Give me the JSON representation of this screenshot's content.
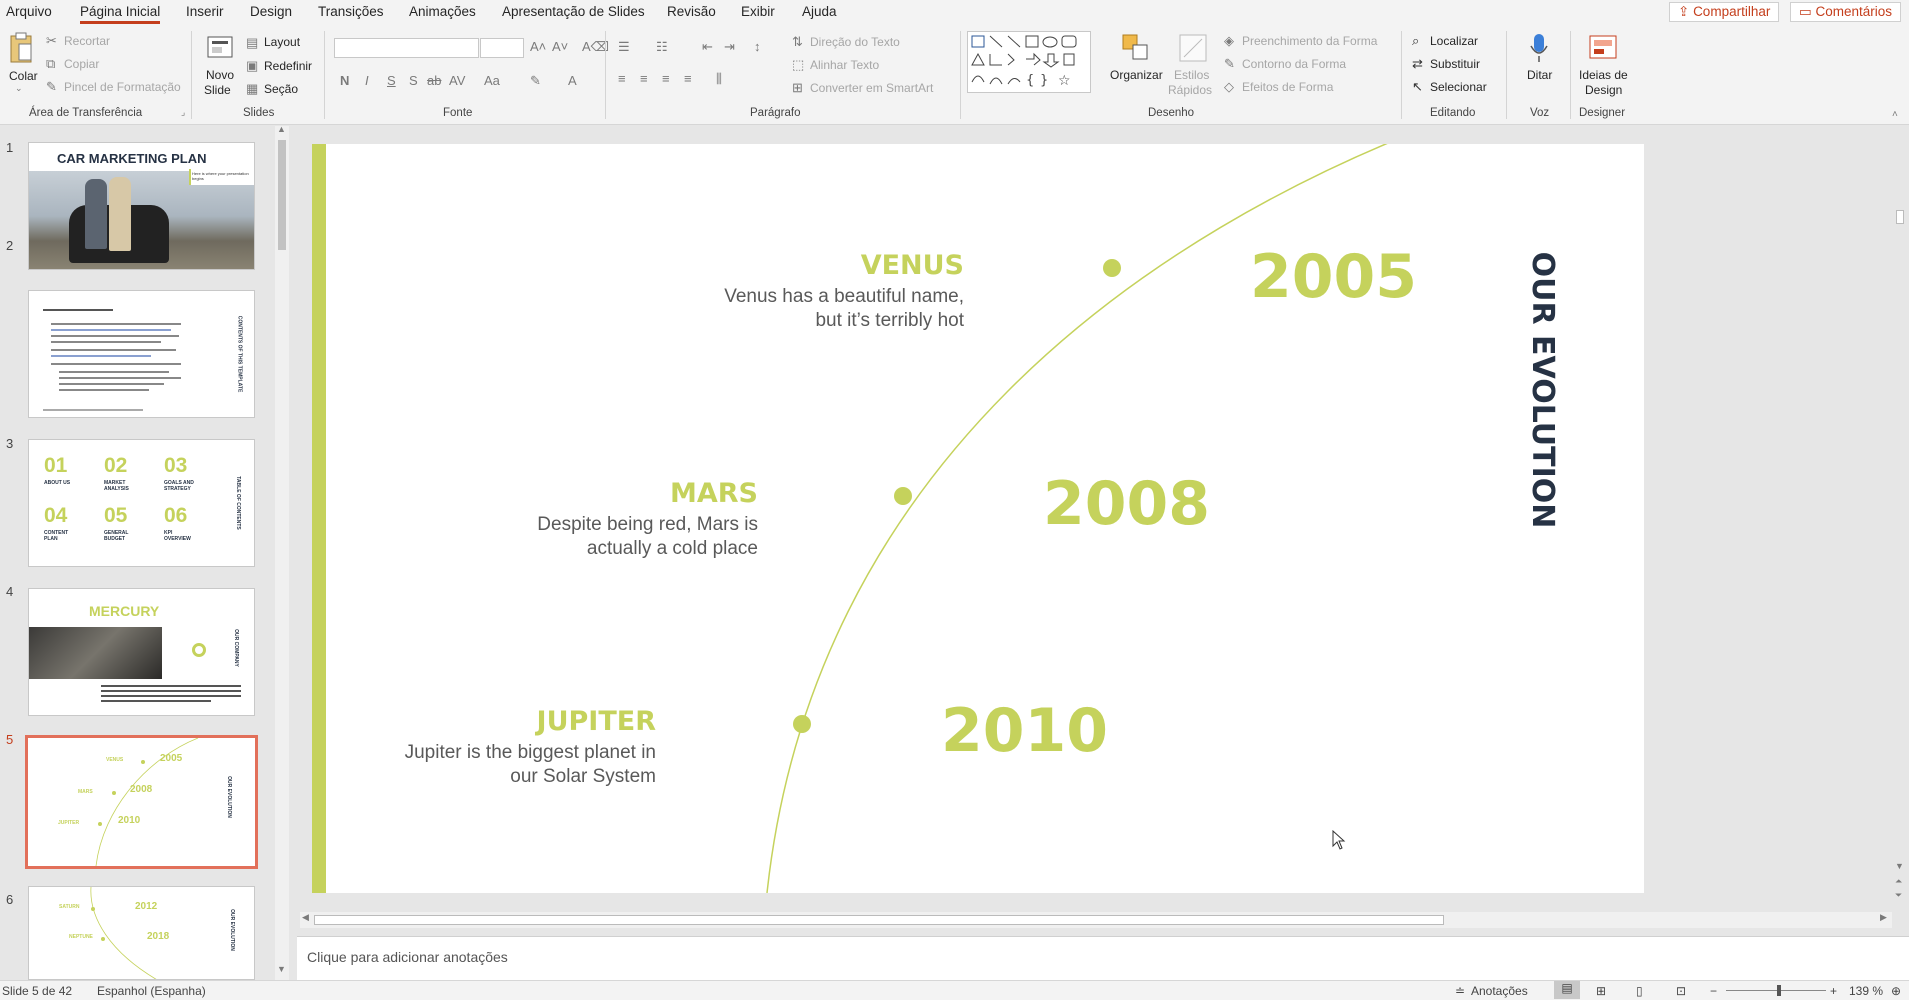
{
  "menu": {
    "tabs": [
      "Arquivo",
      "Página Inicial",
      "Inserir",
      "Design",
      "Transições",
      "Animações",
      "Apresentação de Slides",
      "Revisão",
      "Exibir",
      "Ajuda"
    ],
    "share": "Compartilhar",
    "comments": "Comentários"
  },
  "ribbon": {
    "clipboard": {
      "paste": "Colar",
      "cut": "Recortar",
      "copy": "Copiar",
      "format_painter": "Pincel de Formatação",
      "group": "Área de Transferência"
    },
    "slides": {
      "new_slide_1": "Novo",
      "new_slide_2": "Slide",
      "layout": "Layout",
      "reset": "Redefinir",
      "section": "Seção",
      "group": "Slides"
    },
    "font": {
      "group": "Fonte"
    },
    "paragraph": {
      "text_direction": "Direção do Texto",
      "align_text": "Alinhar Texto",
      "smartart": "Converter em SmartArt",
      "group": "Parágrafo"
    },
    "drawing": {
      "arrange": "Organizar",
      "quick_styles_1": "Estilos",
      "quick_styles_2": "Rápidos",
      "shape_fill": "Preenchimento da Forma",
      "shape_outline": "Contorno da Forma",
      "shape_effects": "Efeitos de Forma",
      "group": "Desenho"
    },
    "editing": {
      "find": "Localizar",
      "replace": "Substituir",
      "select": "Selecionar",
      "group": "Editando"
    },
    "voice": {
      "dictate": "Ditar",
      "group": "Voz"
    },
    "designer": {
      "ideas_1": "Ideias de",
      "ideas_2": "Design",
      "group": "Designer"
    }
  },
  "thumbnails": {
    "numbers": [
      "1",
      "2",
      "3",
      "4",
      "5",
      "6"
    ],
    "s1": {
      "title": "CAR MARKETING PLAN",
      "sub": "Here is where your presentation begins"
    },
    "s3": {
      "items": [
        {
          "n": "01",
          "t": "ABOUT US"
        },
        {
          "n": "02",
          "t": "MARKET ANALYSIS"
        },
        {
          "n": "03",
          "t": "GOALS AND STRATEGY"
        },
        {
          "n": "04",
          "t": "CONTENT PLAN"
        },
        {
          "n": "05",
          "t": "GENERAL BUDGET"
        },
        {
          "n": "06",
          "t": "KPI OVERVIEW"
        }
      ],
      "side": "TABLE OF CONTENTS"
    },
    "s4": {
      "title": "MERCURY",
      "side": "OUR COMPANY"
    },
    "s2": {
      "side": "CONTENTS OF THIS TEMPLATE"
    },
    "s5": {
      "years": [
        "2005",
        "2008",
        "2010"
      ],
      "names": [
        "VENUS",
        "MARS",
        "JUPITER"
      ],
      "side": "OUR EVOLUTION"
    },
    "s6": {
      "years": [
        "2012",
        "2018"
      ],
      "names": [
        "SATURN",
        "NEPTUNE"
      ],
      "side": "OUR EVOLUTION"
    }
  },
  "slide": {
    "side_title": "OUR EVOLUTION",
    "items": [
      {
        "name": "VENUS",
        "desc1": "Venus has a beautiful name,",
        "desc2": "but it’s terribly hot",
        "year": "2005"
      },
      {
        "name": "MARS",
        "desc1": "Despite being red, Mars is",
        "desc2": "actually a cold place",
        "year": "2008"
      },
      {
        "name": "JUPITER",
        "desc1": "Jupiter is the biggest planet in",
        "desc2": "our Solar System",
        "year": "2010"
      }
    ],
    "accent": "#c5d25c",
    "dark": "#263244"
  },
  "notes": {
    "placeholder": "Clique para adicionar anotações"
  },
  "status": {
    "slide": "Slide 5 de 42",
    "language": "Espanhol (Espanha)",
    "notes_btn": "Anotações",
    "zoom": "139 %"
  }
}
